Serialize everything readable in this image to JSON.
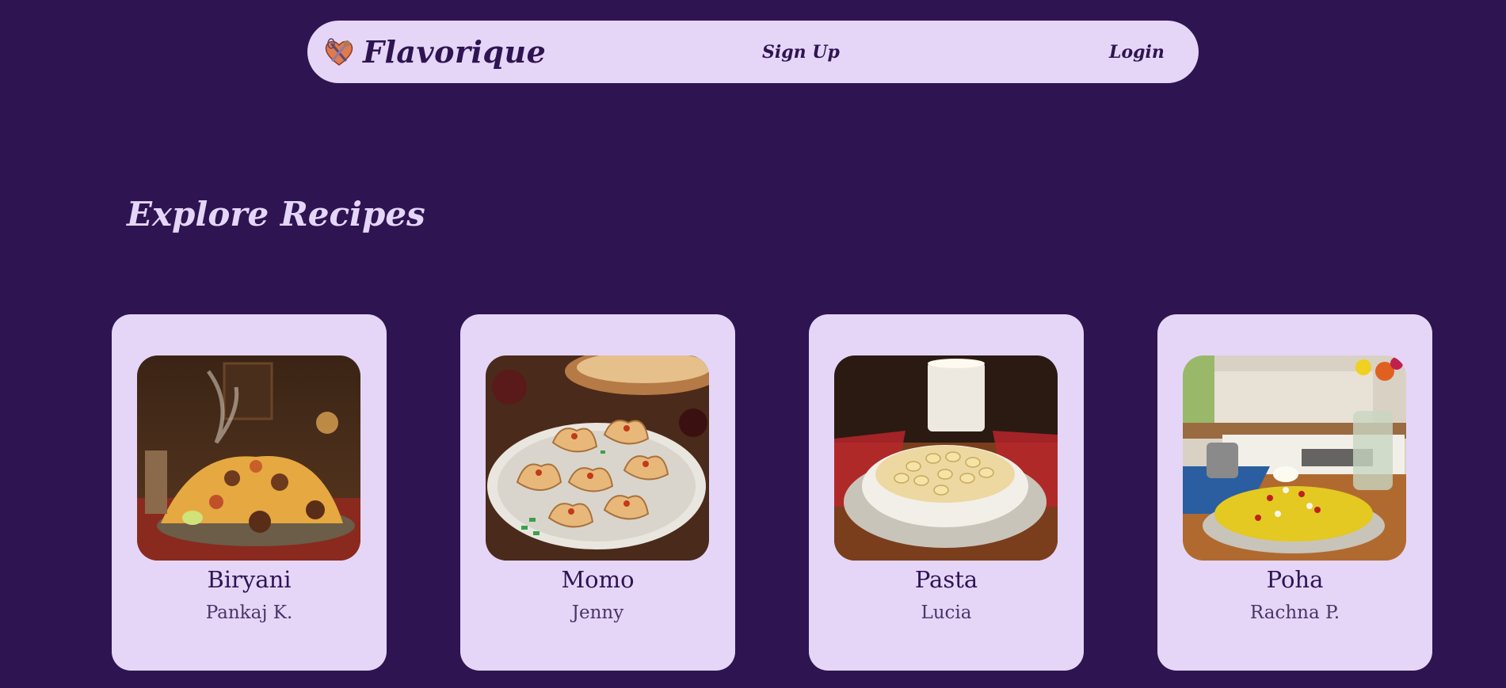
{
  "brand": {
    "name": "Flavorique",
    "logo_icon": "heart-whisk-icon"
  },
  "nav": {
    "signup_label": "Sign Up",
    "login_label": "Login"
  },
  "section": {
    "title": "Explore Recipes"
  },
  "recipes": [
    {
      "title": "Biryani",
      "author": "Pankaj K.",
      "image": "biryani-plate-image"
    },
    {
      "title": "Momo",
      "author": "Jenny",
      "image": "momo-dumplings-image"
    },
    {
      "title": "Pasta",
      "author": "Lucia",
      "image": "mac-and-cheese-image"
    },
    {
      "title": "Poha",
      "author": "Rachna P.",
      "image": "poha-plate-image"
    }
  ],
  "colors": {
    "background": "#2f1452",
    "surface": "#e5d6f8",
    "text_dark": "#2f1452",
    "text_light": "#e5d6f8"
  }
}
